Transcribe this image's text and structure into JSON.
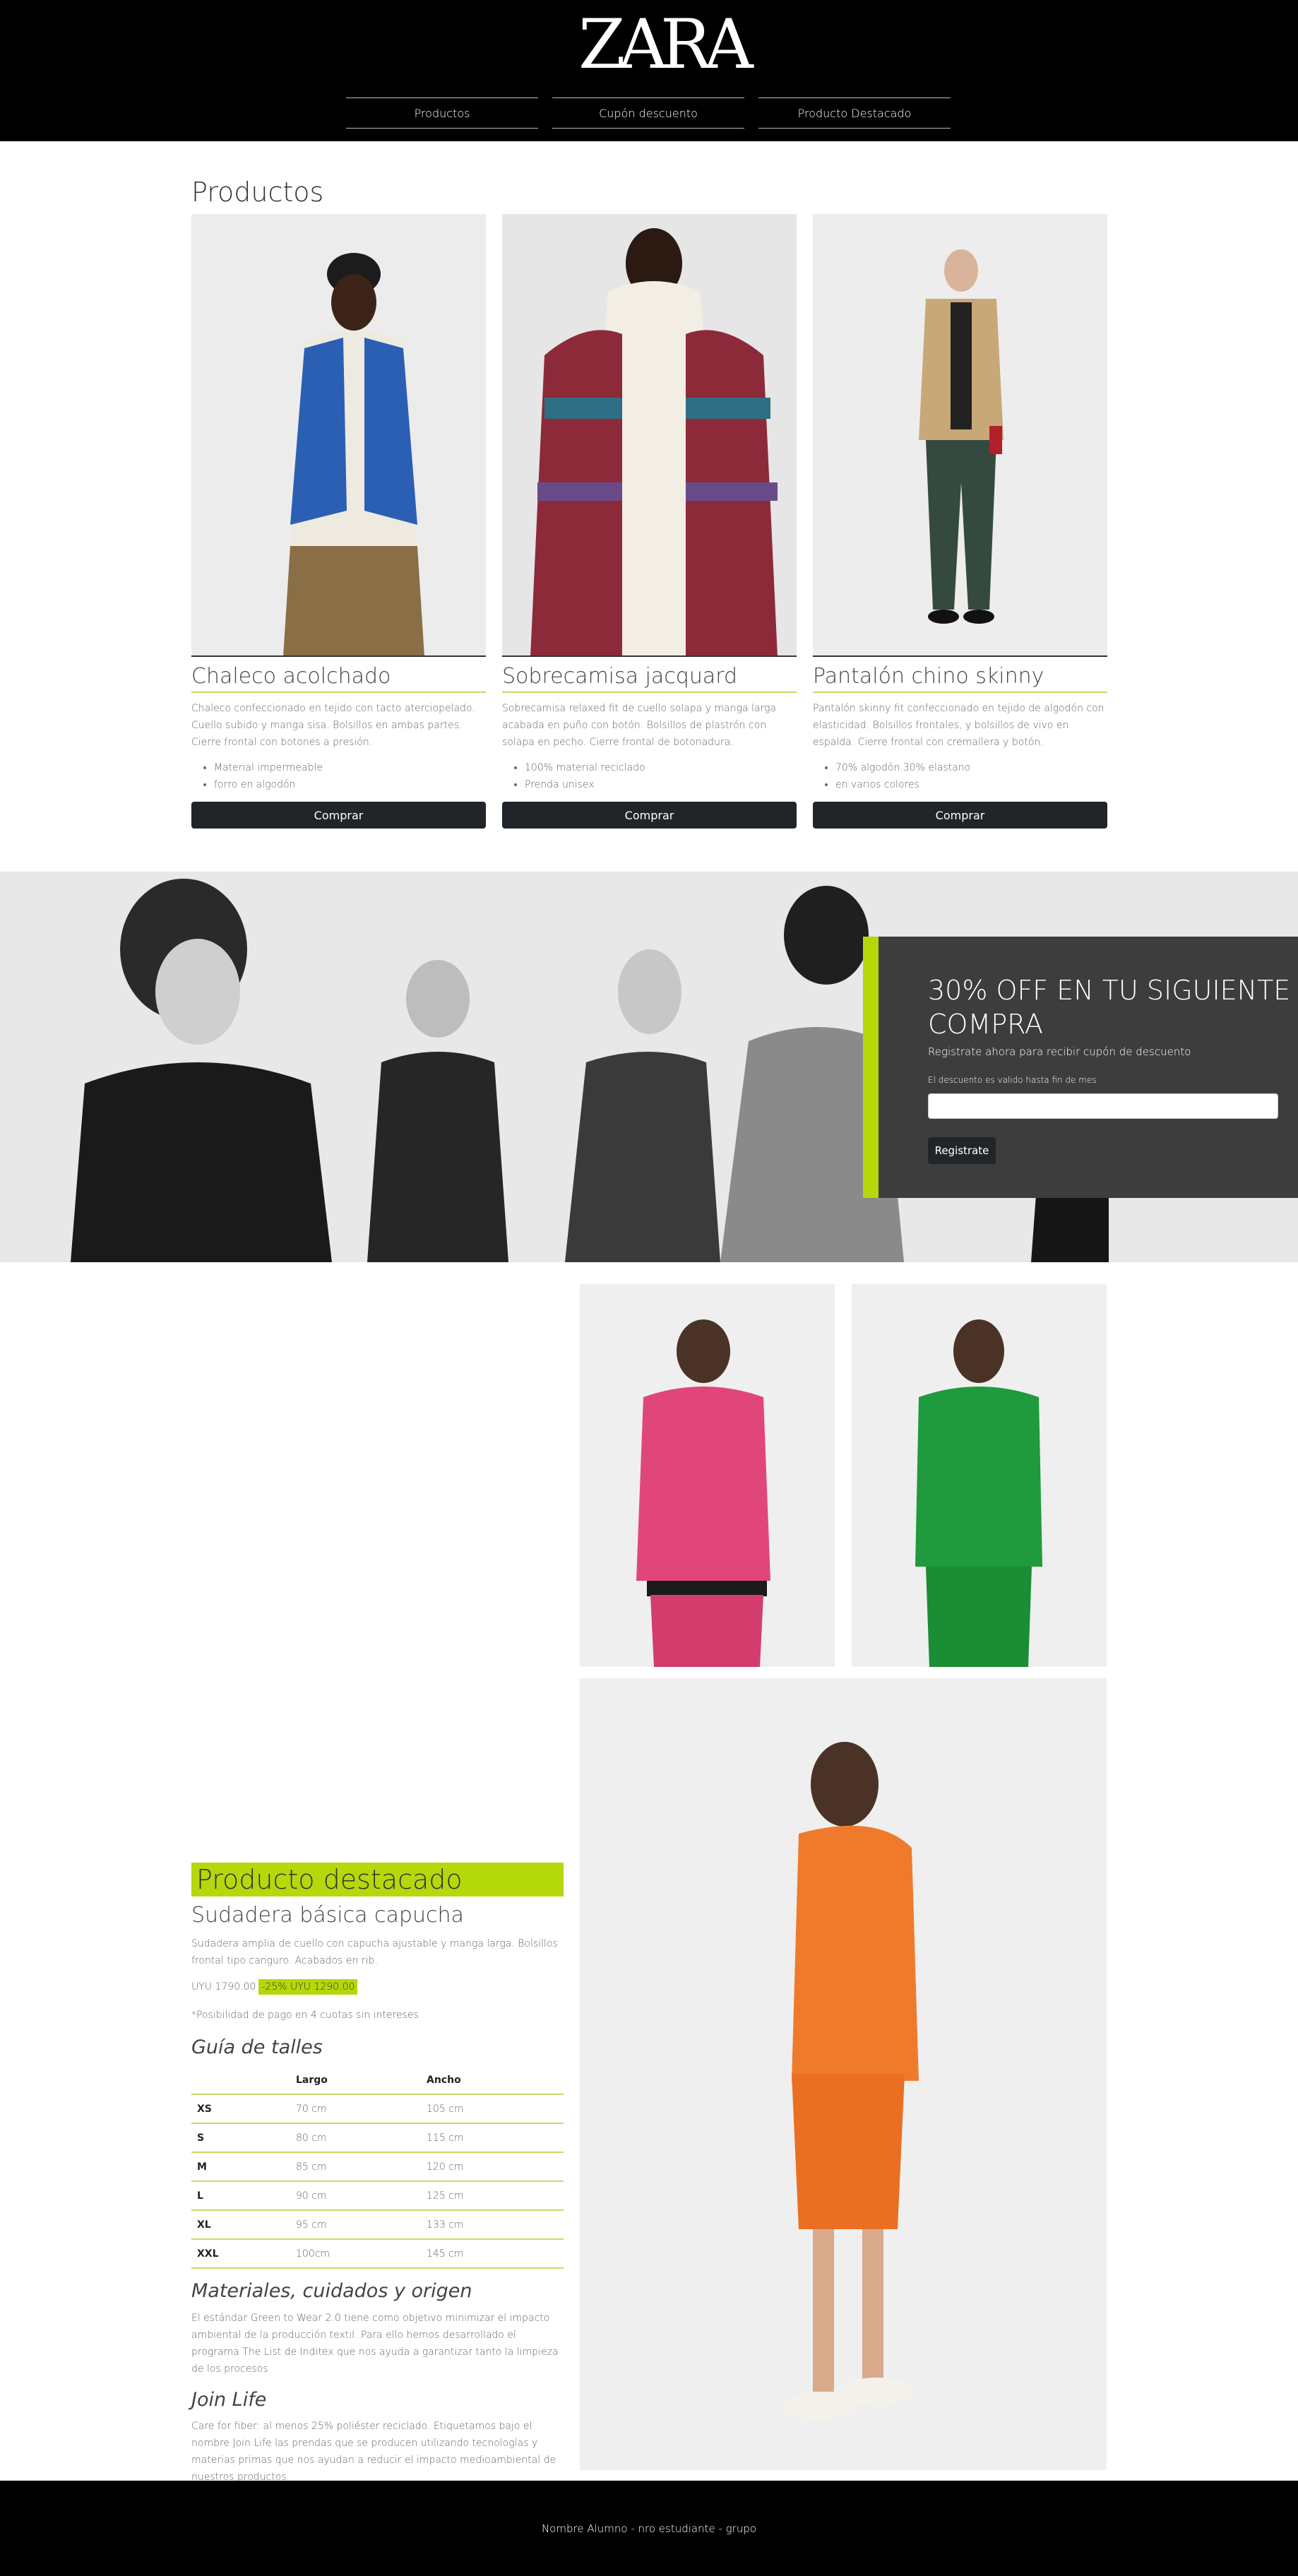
{
  "brand": {
    "logo_text": "ZARA"
  },
  "nav": {
    "items": [
      "Productos",
      "Cupón descuento",
      "Producto Destacado"
    ]
  },
  "products": {
    "title": "Productos",
    "items": [
      {
        "name": "Chaleco acolchado",
        "description": "Chaleco confeccionado en tejido con tacto aterciopelado. Cuello subido y manga sisa. Bolsillos en ambas partes. Cierre frontal con botones a presión.",
        "features": [
          "Material impermeable",
          "forro en algodón"
        ],
        "button": "Comprar"
      },
      {
        "name": "Sobrecamisa jacquard",
        "description": "Sobrecamisa relaxed fit de cuello solapa y manga larga acabada en puño con botón. Bolsillos de plastrón con solapa en pecho. Cierre frontal de botonadura.",
        "features": [
          "100% material reciclado",
          "Prenda unisex"
        ],
        "button": "Comprar"
      },
      {
        "name": "Pantalón chino skinny",
        "description": "Pantalón skinny fit confeccionado en tejido de algodón con elasticidad. Bolsillos frontales, y bolsillos de vivo en espalda. Cierre frontal con cremallera y botón.",
        "features": [
          "70% algodón 30% elastano",
          "en varios colores"
        ],
        "button": "Comprar"
      }
    ]
  },
  "promo": {
    "title": "30% OFF EN TU SIGUIENTE COMPRA",
    "subtitle": "Registrate ahora para recibir cupón de descuento",
    "hint": "El descuento es valido hasta fin de mes",
    "input_value": "",
    "button": "Registrate"
  },
  "featured": {
    "section_title": "Producto destacado",
    "name": "Sudadera básica capucha",
    "description": "Sudadera amplia de cuello con capucha ajustable y manga larga. Bolsillos frontal tipo canguro. Acabados en rib.",
    "price_old": "UYU 1790.00",
    "price_new": "-25% UYU 1290.00",
    "installments": "*Posibilidad de pago en 4 cuotas sin intereses",
    "size_guide_title": "Guía de talles",
    "size_table": {
      "headers": [
        "",
        "Largo",
        "Ancho"
      ],
      "rows": [
        [
          "XS",
          "70 cm",
          "105 cm"
        ],
        [
          "S",
          "80 cm",
          "115 cm"
        ],
        [
          "M",
          "85 cm",
          "120 cm"
        ],
        [
          "L",
          "90 cm",
          "125 cm"
        ],
        [
          "XL",
          "95 cm",
          "133 cm"
        ],
        [
          "XXL",
          "100cm",
          "145 cm"
        ]
      ]
    },
    "materials_title": "Materiales, cuidados y origen",
    "materials_text": "El estándar Green to Wear 2.0 tiene como objetivo minimizar el impacto ambiental de la producción textil. Para ello hemos desarrollado el programa The List de Inditex que nos ayuda a garantizar tanto la limpieza de los procesos",
    "joinlife_title": "Join Life",
    "joinlife_text": "Care for fiber: al menos 25% poliéster reciclado. Etiquetamos bajo el nombre Join Life las prendas que se producen utilizando tecnologías y materias primas que nos ayudan a reducir el impacto medioambiental de nuestros productos."
  },
  "footer": {
    "text": "Nombre Alumno - nro estudiante - grupo"
  },
  "colors": {
    "accent": "#b5d80a",
    "dark": "#212529",
    "header_bg": "#000000",
    "promo_bg": "#3d3d3d"
  }
}
